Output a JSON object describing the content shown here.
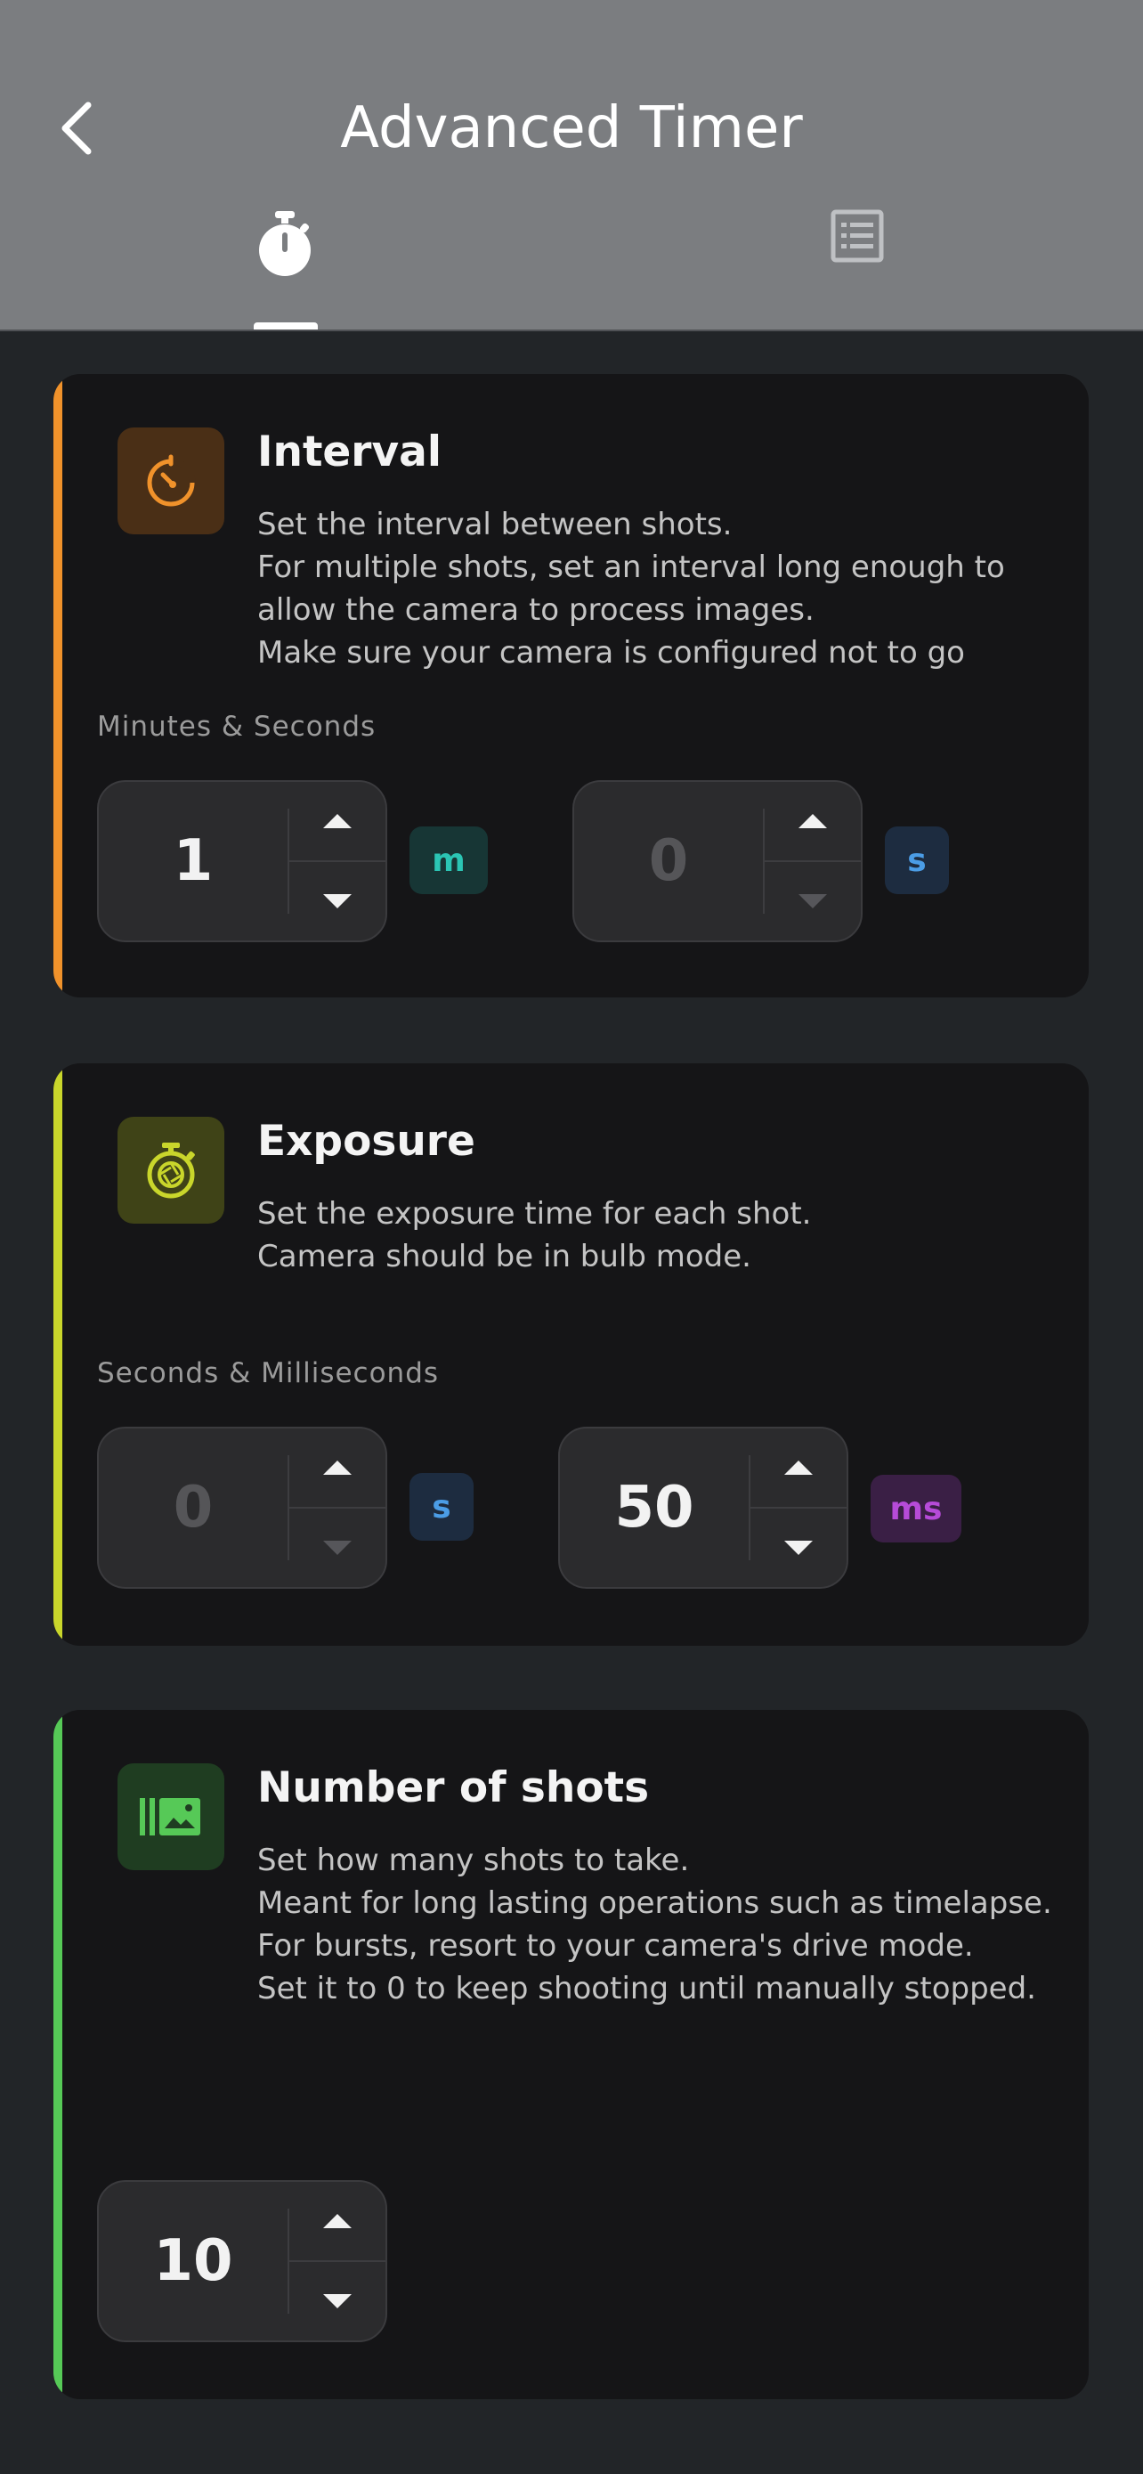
{
  "header": {
    "title": "Advanced Timer",
    "back_icon": "chevron-left-icon",
    "tabs": [
      {
        "icon": "stopwatch-icon",
        "active": true
      },
      {
        "icon": "list-icon",
        "active": false
      }
    ]
  },
  "cards": {
    "interval": {
      "title": "Interval",
      "description": "Set the interval between shots.\nFor multiple shots, set an interval long enough to allow the camera to process images.\nMake sure your camera is configured not to go",
      "section_label": "Minutes & Seconds",
      "accent": "#f0922b",
      "minutes": {
        "value": "1",
        "unit": "m"
      },
      "seconds": {
        "value": "0",
        "unit": "s"
      }
    },
    "exposure": {
      "title": "Exposure",
      "description": "Set the exposure time for each shot.\nCamera should be in bulb mode.",
      "section_label": "Seconds & Milliseconds",
      "accent": "#c9d62b",
      "seconds": {
        "value": "0",
        "unit": "s"
      },
      "milliseconds": {
        "value": "50",
        "unit": "ms"
      }
    },
    "shots": {
      "title": "Number of shots",
      "description": "Set how many shots to take.\nMeant for long lasting operations such as timelapse. For bursts, resort to your camera's drive mode.\nSet it to 0 to keep shooting until manually stopped.",
      "accent": "#56c957",
      "count": {
        "value": "10"
      }
    }
  },
  "colors": {
    "appbar": "#7b7d80",
    "background": "#222528",
    "card": "#151517",
    "unit_m": "#2bc5b4",
    "unit_s": "#4b9de6",
    "unit_ms": "#b64bd8"
  }
}
